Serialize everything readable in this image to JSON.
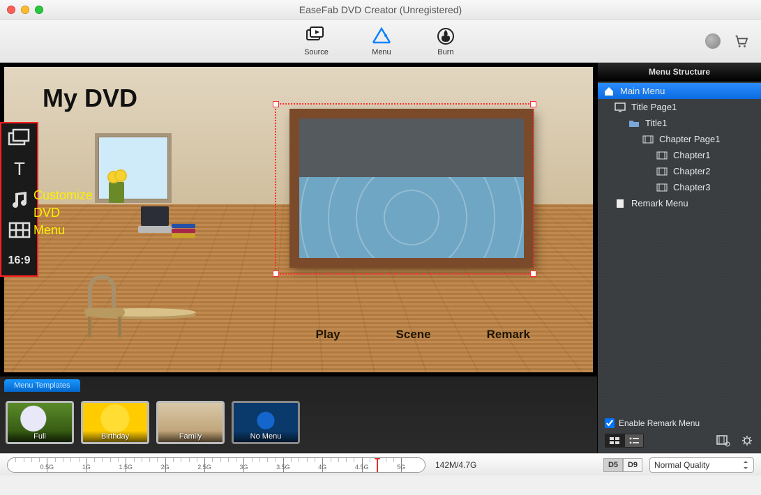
{
  "window": {
    "title": "EaseFab DVD Creator (Unregistered)"
  },
  "toolbar": {
    "source": "Source",
    "menu": "Menu",
    "burn": "Burn"
  },
  "preview": {
    "title": "My DVD",
    "buttons": {
      "play": "Play",
      "scene": "Scene",
      "remark": "Remark"
    }
  },
  "customize": {
    "label_line1": "Customize",
    "label_line2": "DVD",
    "label_line3": "Menu",
    "ratio": "16:9"
  },
  "templates": {
    "tab": "Menu Templates",
    "items": [
      {
        "label": "Full"
      },
      {
        "label": "Birthday"
      },
      {
        "label": "Family"
      },
      {
        "label": "No Menu"
      }
    ]
  },
  "structure": {
    "header": "Menu Structure",
    "tree": {
      "main": "Main Menu",
      "titlepage": "Title Page1",
      "title": "Title1",
      "chapterpage": "Chapter Page1",
      "chapters": [
        "Chapter1",
        "Chapter2",
        "Chapter3"
      ],
      "remark": "Remark Menu"
    },
    "enable_remark": "Enable Remark Menu"
  },
  "status": {
    "ticks": [
      "0.5G",
      "1G",
      "1.5G",
      "2G",
      "2.5G",
      "3G",
      "3.5G",
      "4G",
      "4.5G",
      "5G"
    ],
    "size": "142M/4.7G",
    "d_buttons": [
      "D5",
      "D9"
    ],
    "quality": "Normal Quality"
  }
}
